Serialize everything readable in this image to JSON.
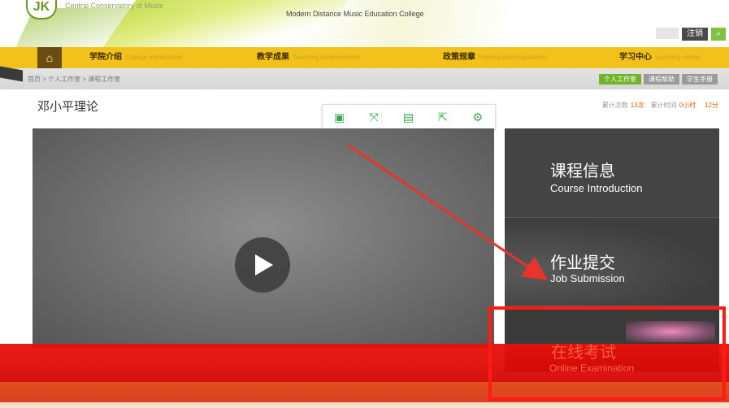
{
  "header": {
    "logo_mark": "JK",
    "logo_text": "Central Conservatory of Music",
    "college_name": "Modern Distance Music Education College",
    "login_label": "注销",
    "search_icon": "search-icon"
  },
  "nav": {
    "home_icon": "home-icon",
    "items": [
      {
        "zh": "学院介绍",
        "en": "College introduction"
      },
      {
        "zh": "教学成果",
        "en": "Teaching achievements"
      },
      {
        "zh": "政策规章",
        "en": "Policies and regulations"
      },
      {
        "zh": "学习中心",
        "en": "Learning center"
      }
    ]
  },
  "breadcrumb": "首页 > 个人工作室 > 课程工作室",
  "crumb_buttons": [
    {
      "label": "个人工作室",
      "active": true
    },
    {
      "label": "课程帮助",
      "active": false
    },
    {
      "label": "学生手册",
      "active": false
    }
  ],
  "page_title": "邓小平理论",
  "stats": [
    {
      "label": "累计次数",
      "value": "13次"
    },
    {
      "label": "累计时间",
      "value": "0小时"
    },
    {
      "label": "",
      "value": "12分"
    }
  ],
  "toolbar_icons": [
    "notes-icon",
    "fullscreen-icon",
    "screen-icon",
    "share-icon",
    "settings-icon"
  ],
  "video": {
    "play_icon": "play-icon"
  },
  "side_cards": [
    {
      "zh": "课程信息",
      "en": "Course Introduction"
    },
    {
      "zh": "作业提交",
      "en": "Job Submission"
    },
    {
      "zh": "在线考试",
      "en": "Online Examination"
    }
  ],
  "colors": {
    "nav_yellow": "#f2c21a",
    "accent_green": "#6fb52a",
    "panel_dark": "#3d3d3d",
    "annotation_red": "#ff1a12"
  }
}
